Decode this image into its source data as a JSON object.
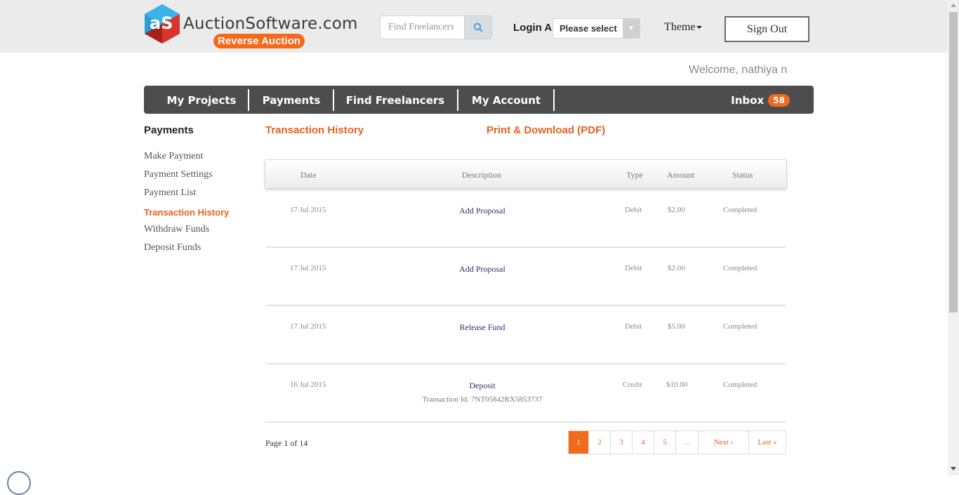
{
  "header": {
    "logo_text": "AuctionSoftware.com",
    "logo_badge": "Reverse Auction",
    "search_placeholder": "Find Freelancers",
    "login_as_label": "Login As",
    "login_select_value": "Please select",
    "theme_label": "Theme",
    "sign_out_label": "Sign Out"
  },
  "welcome_text": "Welcome, nathiya n",
  "nav": {
    "items": [
      "My Projects",
      "Payments",
      "Find Freelancers",
      "My Account"
    ],
    "inbox_label": "Inbox",
    "inbox_count": "58"
  },
  "sidebar": {
    "title": "Payments",
    "items": [
      "Make Payment",
      "Payment Settings",
      "Payment List",
      "Transaction History",
      "Withdraw Funds",
      "Deposit Funds"
    ],
    "active": "Transaction History"
  },
  "main": {
    "title": "Transaction History",
    "pdf_link": "Print & Download (PDF)",
    "columns": [
      "Date",
      "Description",
      "Type",
      "Amount",
      "Status"
    ],
    "rows": [
      {
        "date": "17 Jul 2015",
        "description": "Add Proposal",
        "txid": "",
        "type": "Debit",
        "amount": "$2.00",
        "status": "Completed"
      },
      {
        "date": "17 Jul 2015",
        "description": "Add Proposal",
        "txid": "",
        "type": "Debit",
        "amount": "$2.00",
        "status": "Completed"
      },
      {
        "date": "17 Jul 2015",
        "description": "Release Fund",
        "txid": "",
        "type": "Debit",
        "amount": "$5.00",
        "status": "Completed"
      },
      {
        "date": "16 Jul 2015",
        "description": "Deposit",
        "txid": "Transaction Id: 7NT05842RX5853737",
        "type": "Credit",
        "amount": "$10.00",
        "status": "Completed"
      }
    ],
    "page_info": "Page 1 of 14",
    "pager": [
      "1",
      "2",
      "3",
      "4",
      "5",
      "...",
      "Next ›",
      "Last »"
    ]
  },
  "colors": {
    "accent": "#f26a1b",
    "nav_bg": "#4d4d4d",
    "topbar_bg": "#ebebeb",
    "description_link": "#2b2f6e"
  }
}
